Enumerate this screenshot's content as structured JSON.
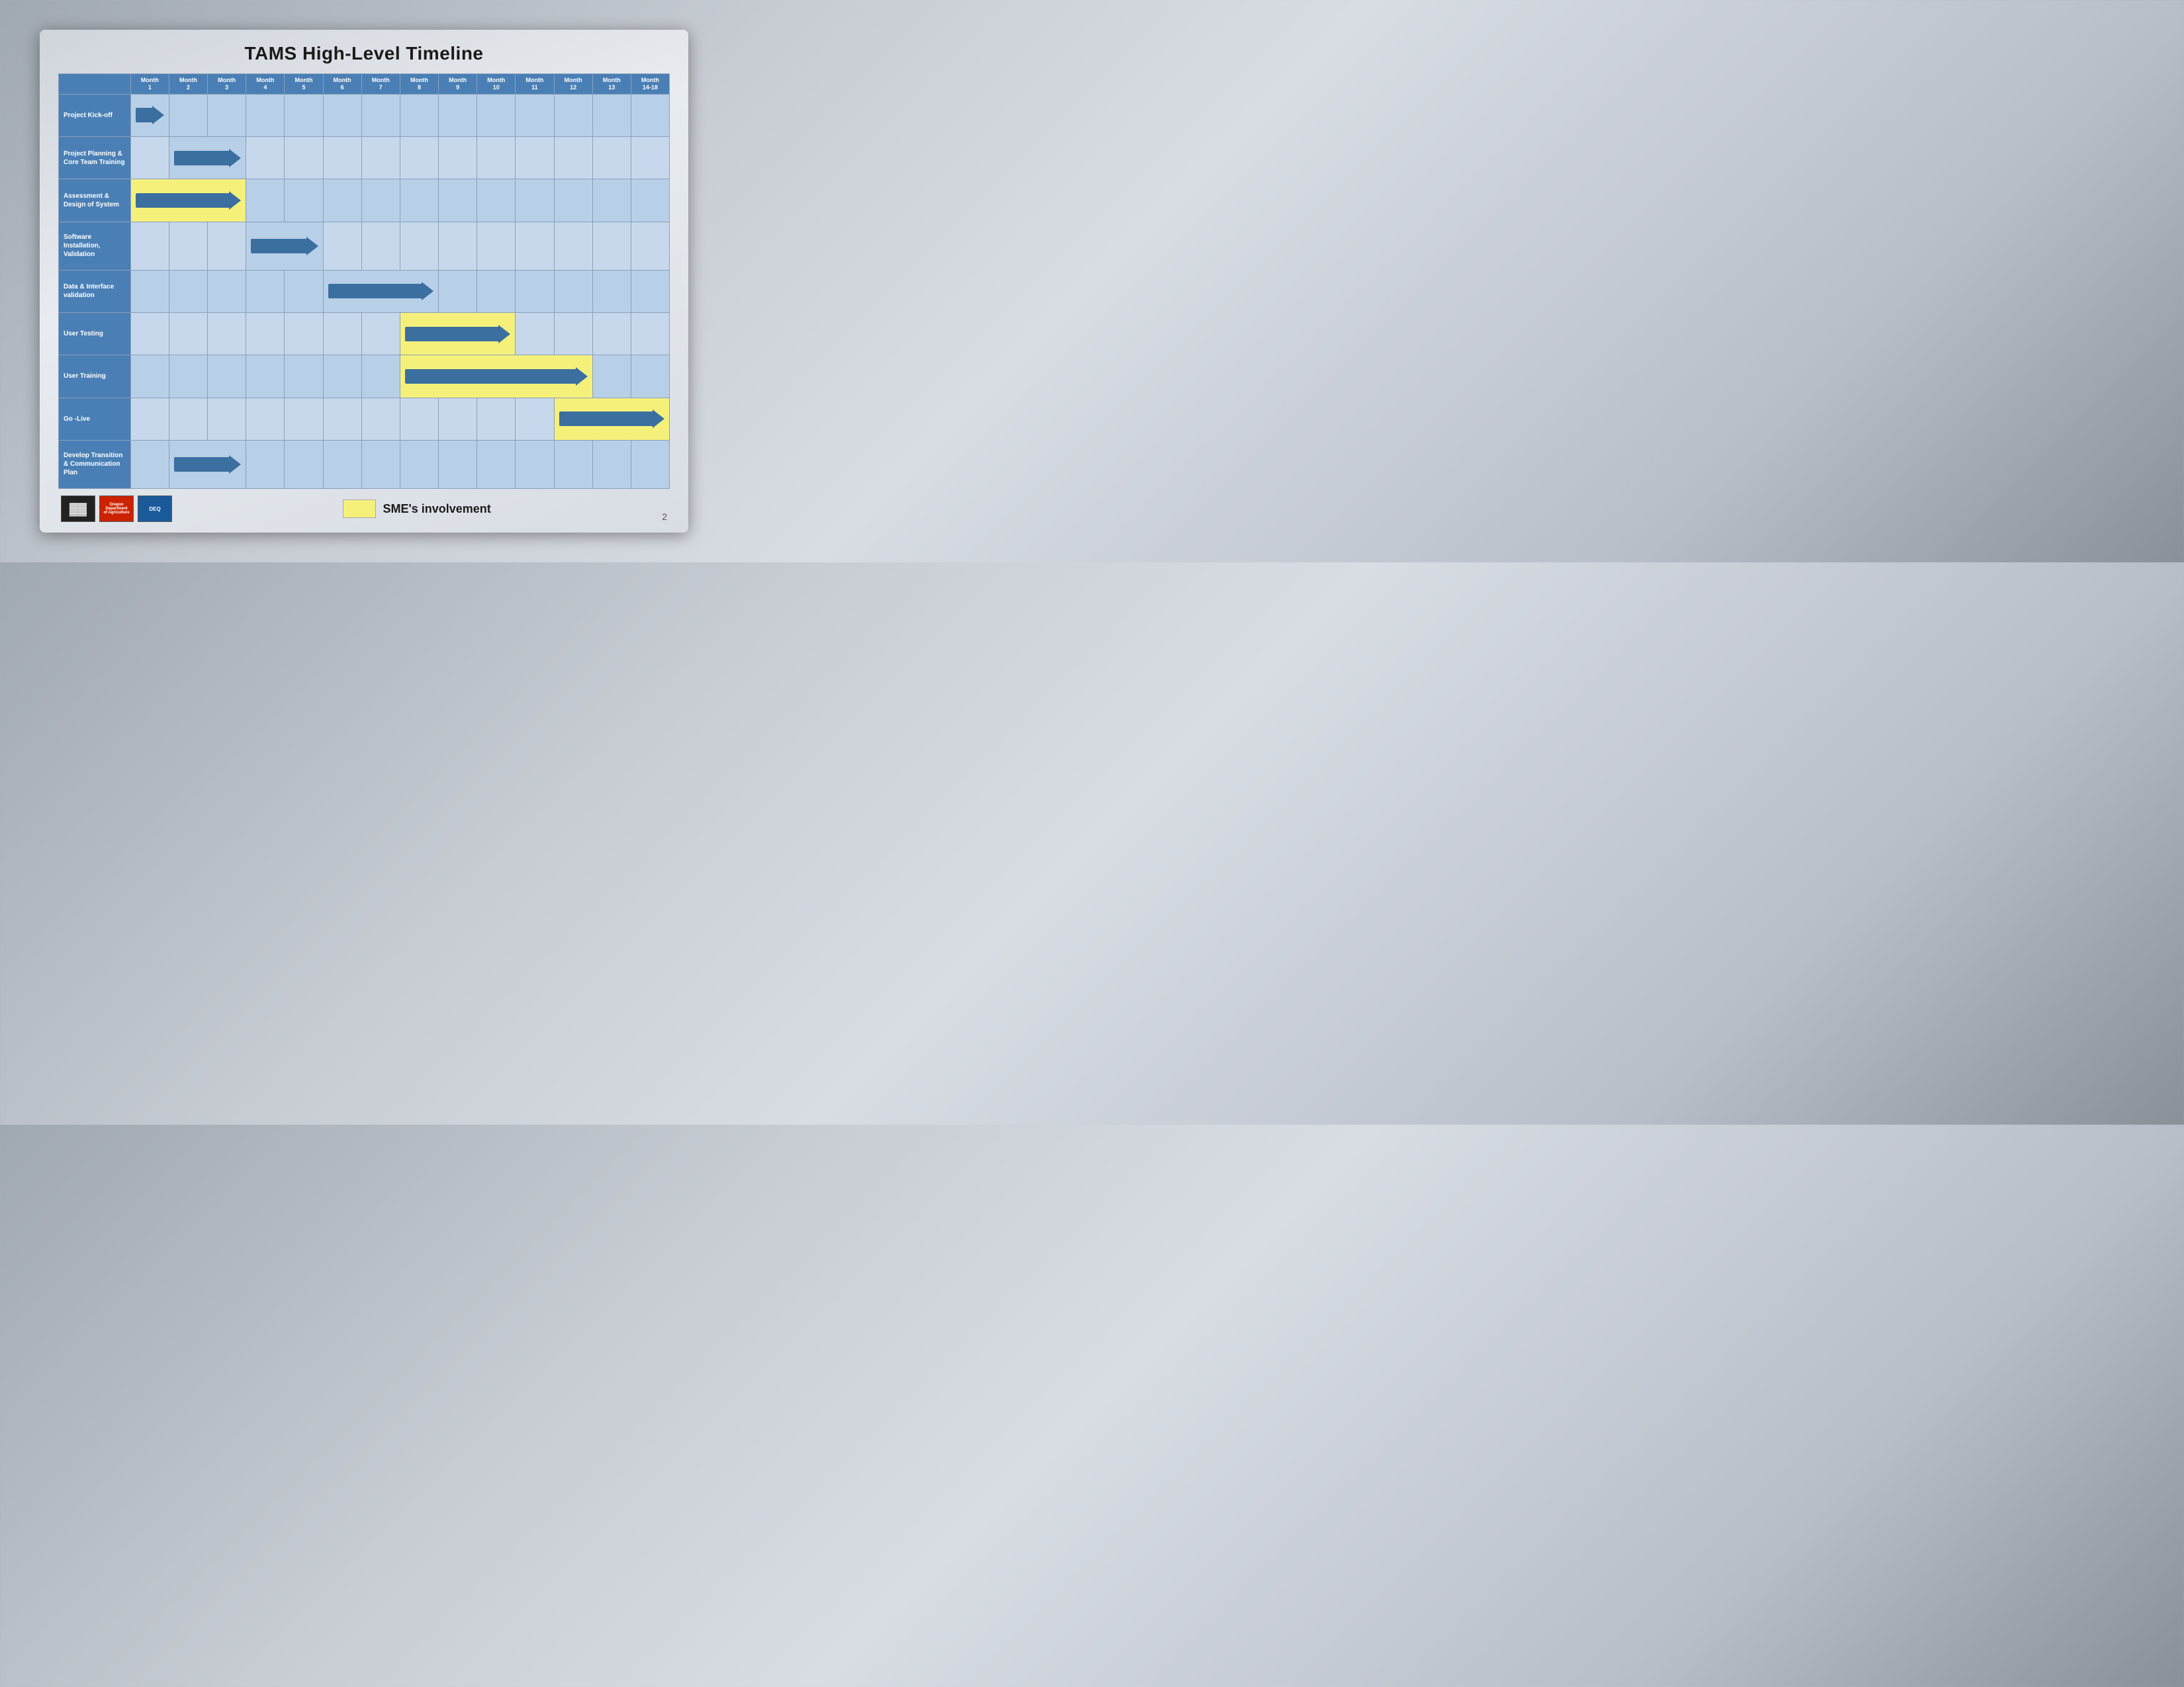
{
  "title": "TAMS High-Level Timeline",
  "months": [
    {
      "label": "Month",
      "sub": "1"
    },
    {
      "label": "Month",
      "sub": "2"
    },
    {
      "label": "Month",
      "sub": "3"
    },
    {
      "label": "Month",
      "sub": "4"
    },
    {
      "label": "Month",
      "sub": "5"
    },
    {
      "label": "Month",
      "sub": "6"
    },
    {
      "label": "Month",
      "sub": "7"
    },
    {
      "label": "Month",
      "sub": "8"
    },
    {
      "label": "Month",
      "sub": "9"
    },
    {
      "label": "Month",
      "sub": "10"
    },
    {
      "label": "Month",
      "sub": "11"
    },
    {
      "label": "Month",
      "sub": "12"
    },
    {
      "label": "Month",
      "sub": "13"
    },
    {
      "label": "Month",
      "sub": "14-18"
    }
  ],
  "tasks": [
    {
      "label": "Project Kick-off",
      "arrow_start": 0,
      "arrow_span": 1,
      "yellow": false
    },
    {
      "label": "Project Planning & Core Team Training",
      "arrow_start": 1,
      "arrow_span": 2,
      "yellow": false
    },
    {
      "label": "Assessment & Design of System",
      "arrow_start": 0,
      "arrow_span": 3,
      "yellow": true
    },
    {
      "label": "Software Installation, Validation",
      "arrow_start": 3,
      "arrow_span": 2,
      "yellow": false
    },
    {
      "label": "Data & Interface validation",
      "arrow_start": 5,
      "arrow_span": 3,
      "yellow": false
    },
    {
      "label": "User Testing",
      "arrow_start": 7,
      "arrow_span": 3,
      "yellow": true
    },
    {
      "label": "User Training",
      "arrow_start": 7,
      "arrow_span": 5,
      "yellow": true
    },
    {
      "label": "Go -Live",
      "arrow_start": 11,
      "arrow_span": 3,
      "yellow": true
    },
    {
      "label": "Develop Transition & Communication Plan",
      "arrow_start": 1,
      "arrow_span": 2,
      "yellow": false
    }
  ],
  "legend": {
    "box_label": "",
    "text": "SME's involvement"
  },
  "page_number": "2"
}
